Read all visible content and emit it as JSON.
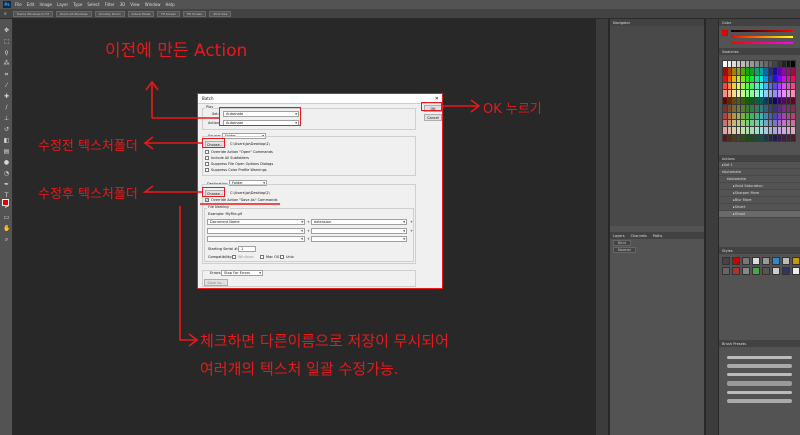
{
  "app": {
    "logo": "Ps"
  },
  "menu": [
    "File",
    "Edit",
    "Image",
    "Layer",
    "Type",
    "Select",
    "Filter",
    "3D",
    "View",
    "Window",
    "Help"
  ],
  "options": [
    "Frame Windows to Fit",
    "Zoom All Windows",
    "Scrubby Zoom",
    "Actual Pixels",
    "Fit Screen",
    "Fill Screen",
    "Print Size"
  ],
  "panels": {
    "navigator": "Navigator",
    "color": "Color",
    "swatches": "Swatches",
    "actions": "Actions",
    "action_rows": [
      "Set 1",
      "Automate",
      "Automate",
      "Vivid Saturation",
      "Sharpen More",
      "Blur More",
      "Smart",
      "Ghost"
    ],
    "layers_tabs": [
      "Layers",
      "Channels",
      "Paths"
    ],
    "layers_kind": "Kind",
    "layers_mode": "Normal",
    "styles": "Styles",
    "brush_presets": "Brush Presets"
  },
  "dialog": {
    "title": "Batch",
    "play_label": "Play",
    "set_label": "Set:",
    "set_value": "Automate",
    "action_label": "Action:",
    "action_value": "Automate",
    "source_label": "Source:",
    "source_value": "Folder",
    "choose_label": "Choose...",
    "source_path": "C:\\Users\\jw\\Desktop\\1\\",
    "checkboxes": [
      "Override Action \"Open\" Commands",
      "Include All Subfolders",
      "Suppress File Open Options Dialogs",
      "Suppress Color Profile Warnings"
    ],
    "dest_label": "Destination:",
    "dest_value": "Folder",
    "choose2_label": "Choose...",
    "dest_path": "C:\\Users\\jw\\Desktop\\2\\",
    "override_save": "Override Action \"Save As\" Commands",
    "file_naming": "File Naming",
    "example": "Example: MyFile.gif",
    "naming_1": "Document Name",
    "naming_2": "extension",
    "plus": "+",
    "serial_label": "Starting Serial #:",
    "serial_value": "1",
    "compat_label": "Compatibility:",
    "compat": [
      "Windows",
      "Mac OS",
      "Unix"
    ],
    "errors_label": "Errors:",
    "errors_value": "Stop For Errors",
    "saveas_label": "Save As...",
    "ok_label": "OK",
    "cancel_label": "Cancel"
  },
  "annotations": {
    "a1": "이전에 만든 Action",
    "a2": "OK 누르기",
    "a3": "수정전 텍스처폴더",
    "a4": "수정후 텍스처폴더",
    "a5": "체크하면 다른이름으로 저장이 무시되어",
    "a6": "여러개의 텍스처 일괄 수정가능."
  },
  "colors": {
    "annotation_red": "#e8191c",
    "fg_color": "#e00000"
  }
}
